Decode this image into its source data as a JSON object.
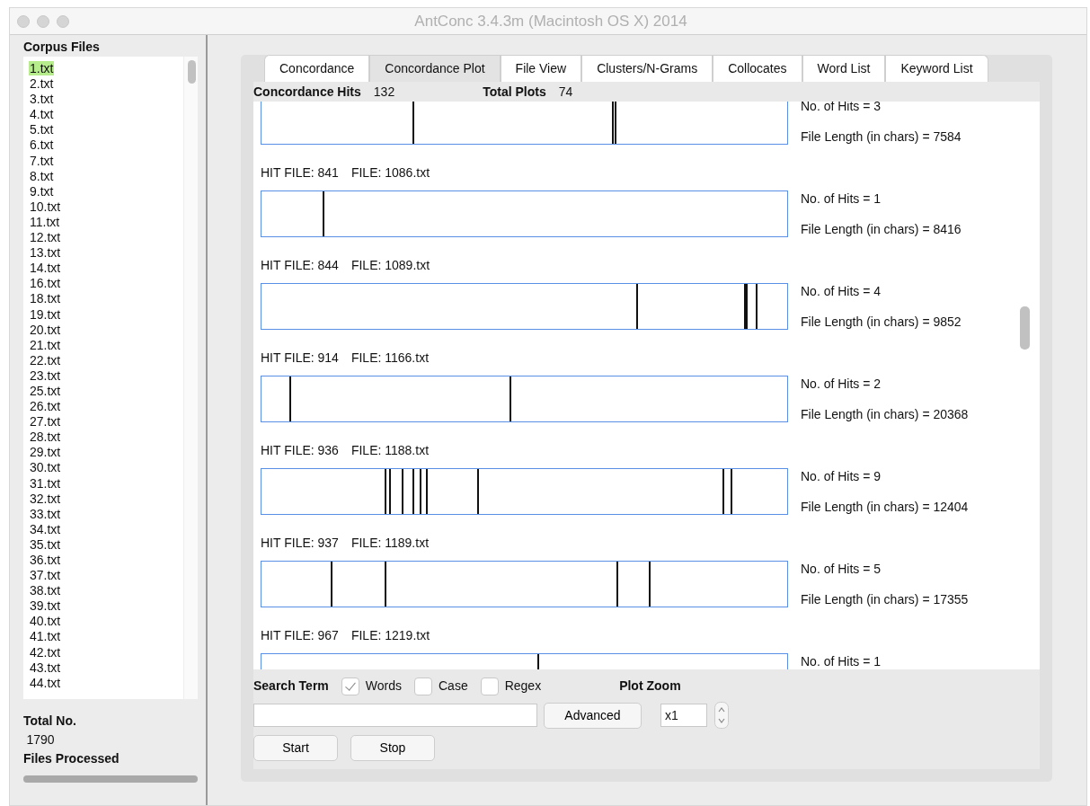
{
  "window": {
    "title": "AntConc 3.4.3m (Macintosh OS X) 2014"
  },
  "corpus_files": {
    "heading": "Corpus Files",
    "items": [
      {
        "label": "1.txt",
        "selected": true
      },
      {
        "label": "2.txt",
        "selected": false
      },
      {
        "label": "3.txt",
        "selected": false
      },
      {
        "label": "4.txt",
        "selected": false
      },
      {
        "label": "5.txt",
        "selected": false
      },
      {
        "label": "6.txt",
        "selected": false
      },
      {
        "label": "7.txt",
        "selected": false
      },
      {
        "label": "8.txt",
        "selected": false
      },
      {
        "label": "9.txt",
        "selected": false
      },
      {
        "label": "10.txt",
        "selected": false
      },
      {
        "label": "11.txt",
        "selected": false
      },
      {
        "label": "12.txt",
        "selected": false
      },
      {
        "label": "13.txt",
        "selected": false
      },
      {
        "label": "14.txt",
        "selected": false
      },
      {
        "label": "16.txt",
        "selected": false
      },
      {
        "label": "18.txt",
        "selected": false
      },
      {
        "label": "19.txt",
        "selected": false
      },
      {
        "label": "20.txt",
        "selected": false
      },
      {
        "label": "21.txt",
        "selected": false
      },
      {
        "label": "22.txt",
        "selected": false
      },
      {
        "label": "23.txt",
        "selected": false
      },
      {
        "label": "25.txt",
        "selected": false
      },
      {
        "label": "26.txt",
        "selected": false
      },
      {
        "label": "27.txt",
        "selected": false
      },
      {
        "label": "28.txt",
        "selected": false
      },
      {
        "label": "29.txt",
        "selected": false
      },
      {
        "label": "30.txt",
        "selected": false
      },
      {
        "label": "31.txt",
        "selected": false
      },
      {
        "label": "32.txt",
        "selected": false
      },
      {
        "label": "33.txt",
        "selected": false
      },
      {
        "label": "34.txt",
        "selected": false
      },
      {
        "label": "35.txt",
        "selected": false
      },
      {
        "label": "36.txt",
        "selected": false
      },
      {
        "label": "37.txt",
        "selected": false
      },
      {
        "label": "38.txt",
        "selected": false
      },
      {
        "label": "39.txt",
        "selected": false
      },
      {
        "label": "40.txt",
        "selected": false
      },
      {
        "label": "41.txt",
        "selected": false
      },
      {
        "label": "42.txt",
        "selected": false
      },
      {
        "label": "43.txt",
        "selected": false
      },
      {
        "label": "44.txt",
        "selected": false
      }
    ],
    "total_label": "Total No.",
    "total_value": "1790",
    "processed_label": "Files Processed",
    "progress": {
      "level": 1
    }
  },
  "tabs": [
    {
      "label": "Concordance",
      "selected": false
    },
    {
      "label": "Concordance Plot",
      "selected": true
    },
    {
      "label": "File View",
      "selected": false
    },
    {
      "label": "Clusters/N-Grams",
      "selected": false
    },
    {
      "label": "Collocates",
      "selected": false
    },
    {
      "label": "Word List",
      "selected": false
    },
    {
      "label": "Keyword List",
      "selected": false
    }
  ],
  "summary": {
    "hits_label": "Concordance Hits",
    "hits_value": "132",
    "plots_label": "Total Plots",
    "plots_value": "74"
  },
  "plots": [
    {
      "hits_text": "No. of Hits = 3",
      "length_text": "File Length (in chars) = 7584",
      "hits": [
        {
          "level": 0.288
        },
        {
          "level": 0.666
        },
        {
          "level": 0.671
        }
      ]
    },
    {
      "hit_file": "HIT FILE: 841",
      "file": "FILE: 1086.txt",
      "hits_text": "No. of Hits = 1",
      "length_text": "File Length (in chars) = 8416",
      "hits": [
        {
          "level": 0.116
        }
      ]
    },
    {
      "hit_file": "HIT FILE: 844",
      "file": "FILE: 1089.txt",
      "hits_text": "No. of Hits = 4",
      "length_text": "File Length (in chars) = 9852",
      "hits": [
        {
          "level": 0.713
        },
        {
          "level": 0.918
        },
        {
          "level": 0.922
        },
        {
          "level": 0.94
        }
      ]
    },
    {
      "hit_file": "HIT FILE: 914",
      "file": "FILE: 1166.txt",
      "hits_text": "No. of Hits = 2",
      "length_text": "File Length (in chars) = 20368",
      "hits": [
        {
          "level": 0.053
        },
        {
          "level": 0.471
        }
      ]
    },
    {
      "hit_file": "HIT FILE: 936",
      "file": "FILE: 1188.txt",
      "hits_text": "No. of Hits = 9",
      "length_text": "File Length (in chars) = 12404",
      "hits": [
        {
          "level": 0.234
        },
        {
          "level": 0.242
        },
        {
          "level": 0.266
        },
        {
          "level": 0.287
        },
        {
          "level": 0.3
        },
        {
          "level": 0.312
        },
        {
          "level": 0.41
        },
        {
          "level": 0.877
        },
        {
          "level": 0.892
        }
      ]
    },
    {
      "hit_file": "HIT FILE: 937",
      "file": "FILE: 1189.txt",
      "hits_text": "No. of Hits = 5",
      "length_text": "File Length (in chars) = 17355",
      "hits": [
        {
          "level": 0.131
        },
        {
          "level": 0.235
        },
        {
          "level": 0.676
        },
        {
          "level": 0.737
        }
      ]
    },
    {
      "hit_file": "HIT FILE: 967",
      "file": "FILE: 1219.txt",
      "hits_text": "No. of Hits = 1",
      "hits": [
        {
          "level": 0.524
        }
      ]
    }
  ],
  "search": {
    "label": "Search Term",
    "options": [
      {
        "label": "Words",
        "checked": true
      },
      {
        "label": "Case",
        "checked": false
      },
      {
        "label": "Regex",
        "checked": false
      }
    ],
    "advanced": "Advanced",
    "start": "Start",
    "stop": "Stop"
  },
  "zoom": {
    "label": "Plot Zoom",
    "value": "x1"
  }
}
